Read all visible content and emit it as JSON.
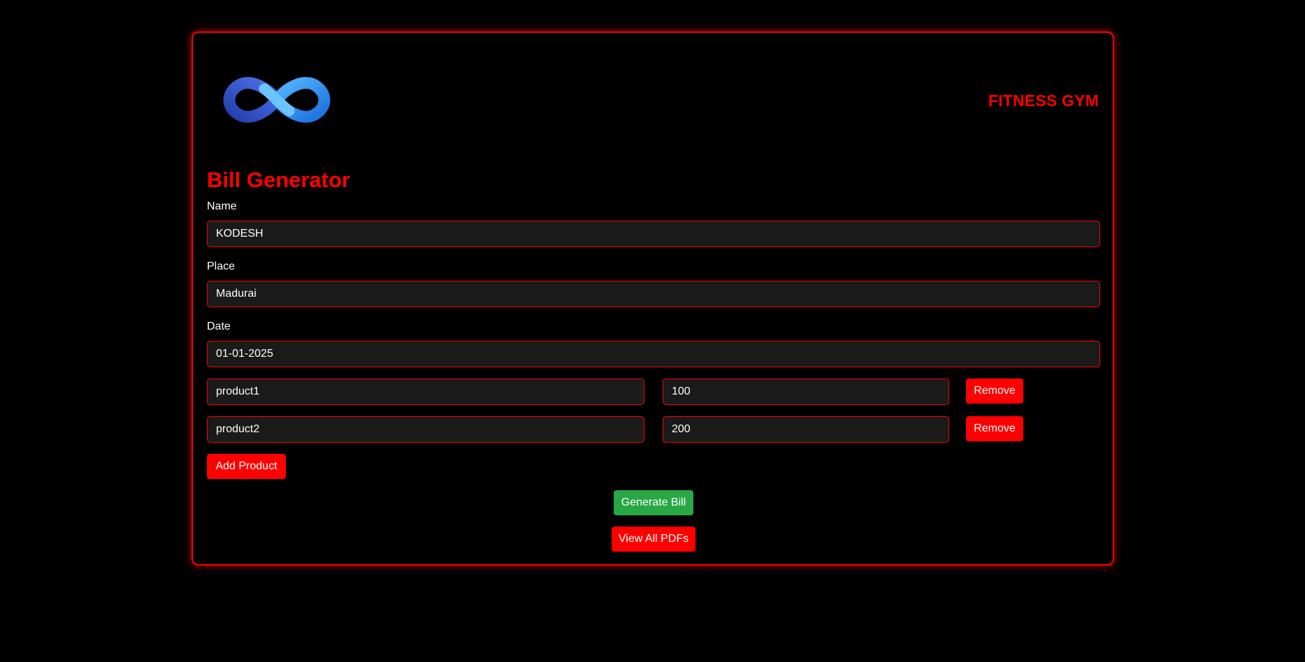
{
  "header": {
    "brand": "FITNESS GYM"
  },
  "logo": {
    "icon": "infinity-logo-icon",
    "colors": [
      "#1e90ff",
      "#3a5fd8"
    ]
  },
  "form": {
    "title": "Bill Generator",
    "name_label": "Name",
    "name_value": "KODESH",
    "place_label": "Place",
    "place_value": "Madurai",
    "date_label": "Date",
    "date_value": "01-01-2025"
  },
  "products": [
    {
      "name": "product1",
      "price": "100",
      "remove_label": "Remove"
    },
    {
      "name": "product2",
      "price": "200",
      "remove_label": "Remove"
    }
  ],
  "actions": {
    "add_product": "Add Product",
    "generate_bill": "Generate Bill",
    "view_pdfs": "View All PDFs"
  },
  "colors": {
    "accent": "#ff0000",
    "success": "#28a745",
    "background": "#000000",
    "field": "#1a1a1a"
  }
}
